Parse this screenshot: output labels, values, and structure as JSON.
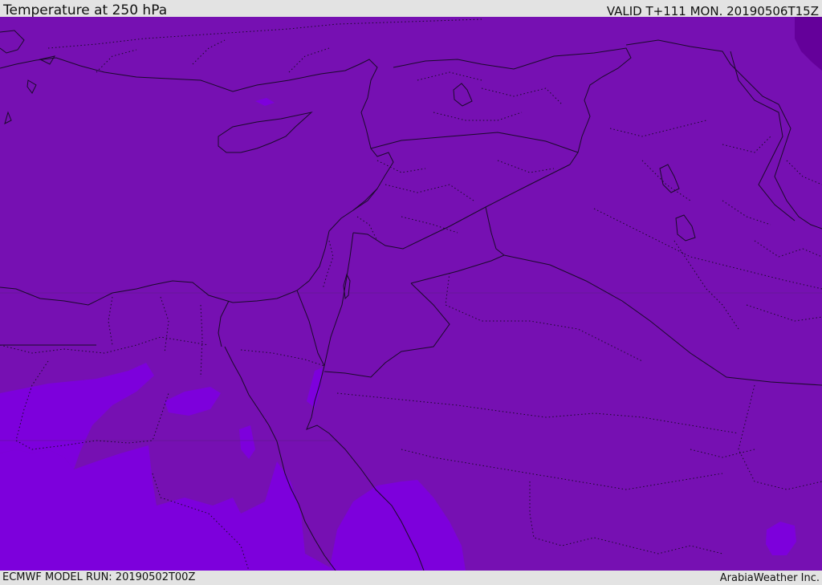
{
  "header": {
    "title": "Temperature at 250 hPa",
    "valid": "VALID T+111 MON. 20190506T15Z"
  },
  "footer": {
    "model_run": "ECMWF MODEL RUN: 20190502T00Z",
    "credit": "ArabiaWeather Inc."
  },
  "colors": {
    "base_fill": "#7610b2",
    "warm_band": "#7d00dc",
    "cold_patch": "#64009a",
    "boundaries": "#1a0a2a"
  },
  "map_features": [
    "coastlines",
    "country-borders",
    "province-borders",
    "temperature-shading"
  ]
}
